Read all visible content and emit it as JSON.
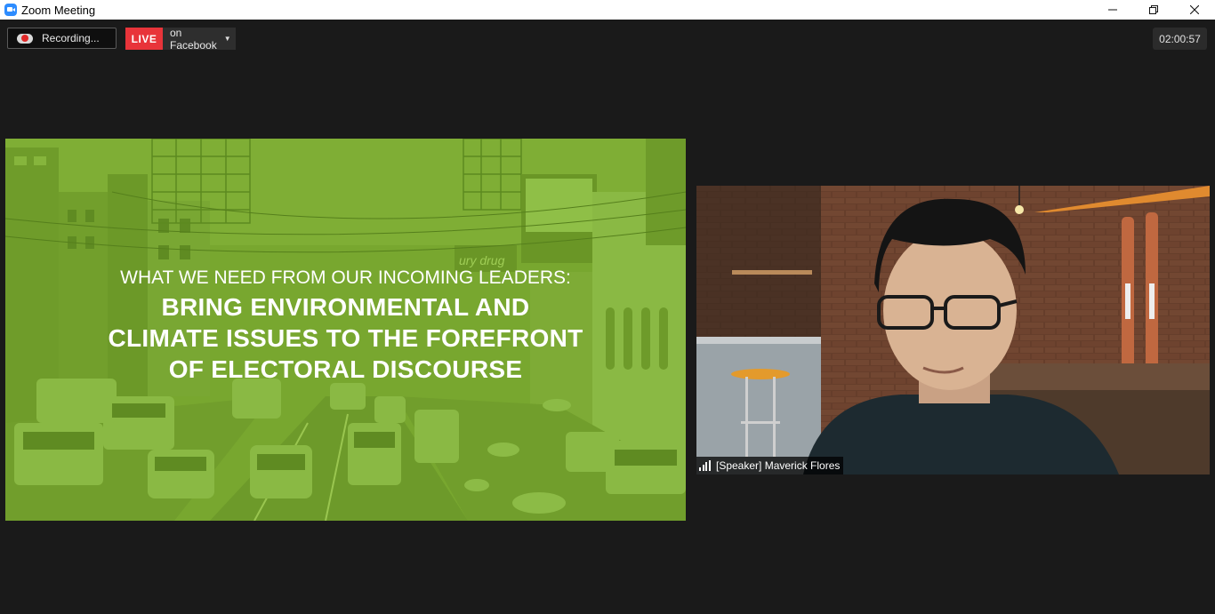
{
  "window": {
    "title": "Zoom Meeting"
  },
  "toolbar": {
    "recording_label": "Recording...",
    "live_label": "LIVE",
    "live_destination": "on Facebook",
    "timer": "02:00:57"
  },
  "slide": {
    "subtitle": "WHAT WE NEED FROM OUR INCOMING LEADERS:",
    "headline_line1": "BRING ENVIRONMENTAL AND",
    "headline_line2": "CLIMATE ISSUES TO THE FOREFRONT",
    "headline_line3": "OF ELECTORAL DISCOURSE",
    "billboard_text": "ury drug",
    "color": "#76a52e"
  },
  "speaker": {
    "name_label": "[Speaker] Maverick Flores"
  },
  "icons": {
    "app": "zoom-camera-icon",
    "recording": "cloud-record-icon",
    "signal": "signal-bars-icon",
    "minimize": "minimize-icon",
    "restore": "restore-icon",
    "close": "close-icon",
    "dropdown": "chevron-down-icon"
  }
}
